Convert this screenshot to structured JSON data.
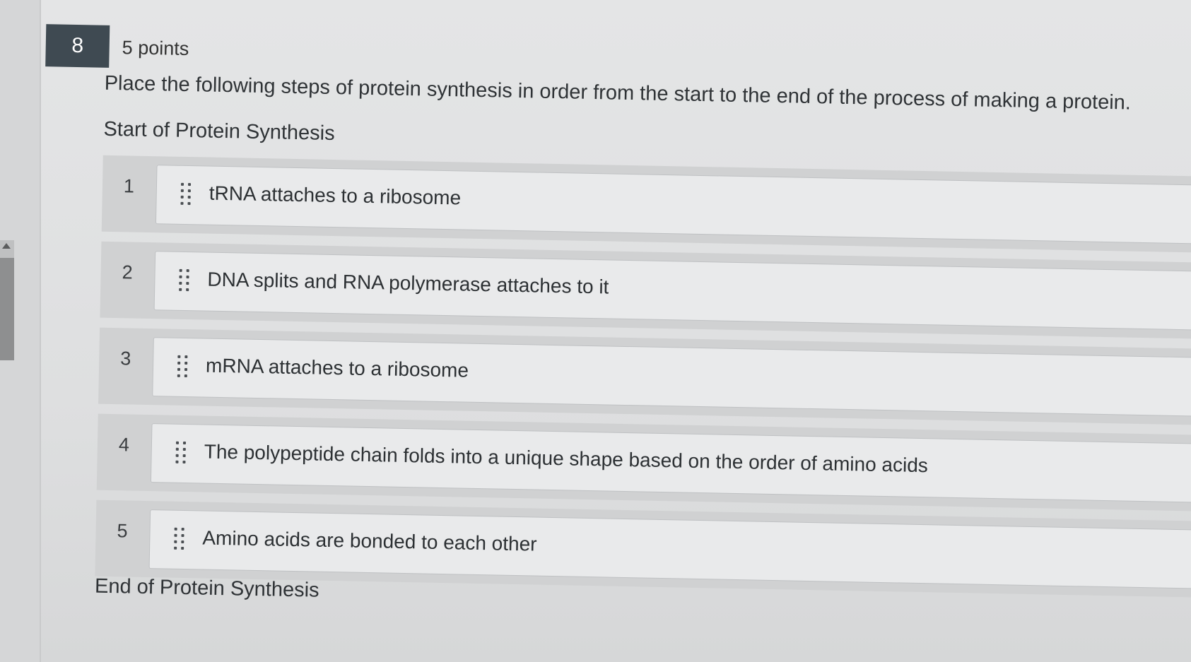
{
  "question": {
    "number": "8",
    "points": "5 points",
    "prompt": "Place the following steps of protein synthesis in order from the start to the end of the process of making a protein.",
    "start_label": "Start of Protein Synthesis",
    "end_label": "End of Protein Synthesis",
    "items": [
      {
        "position": "1",
        "text": "tRNA attaches to a ribosome"
      },
      {
        "position": "2",
        "text": "DNA splits and RNA polymerase attaches to it"
      },
      {
        "position": "3",
        "text": "mRNA attaches to a ribosome"
      },
      {
        "position": "4",
        "text": "The polypeptide chain folds into a unique shape based on the order of amino acids"
      },
      {
        "position": "5",
        "text": "Amino acids are bonded to each other"
      }
    ]
  }
}
